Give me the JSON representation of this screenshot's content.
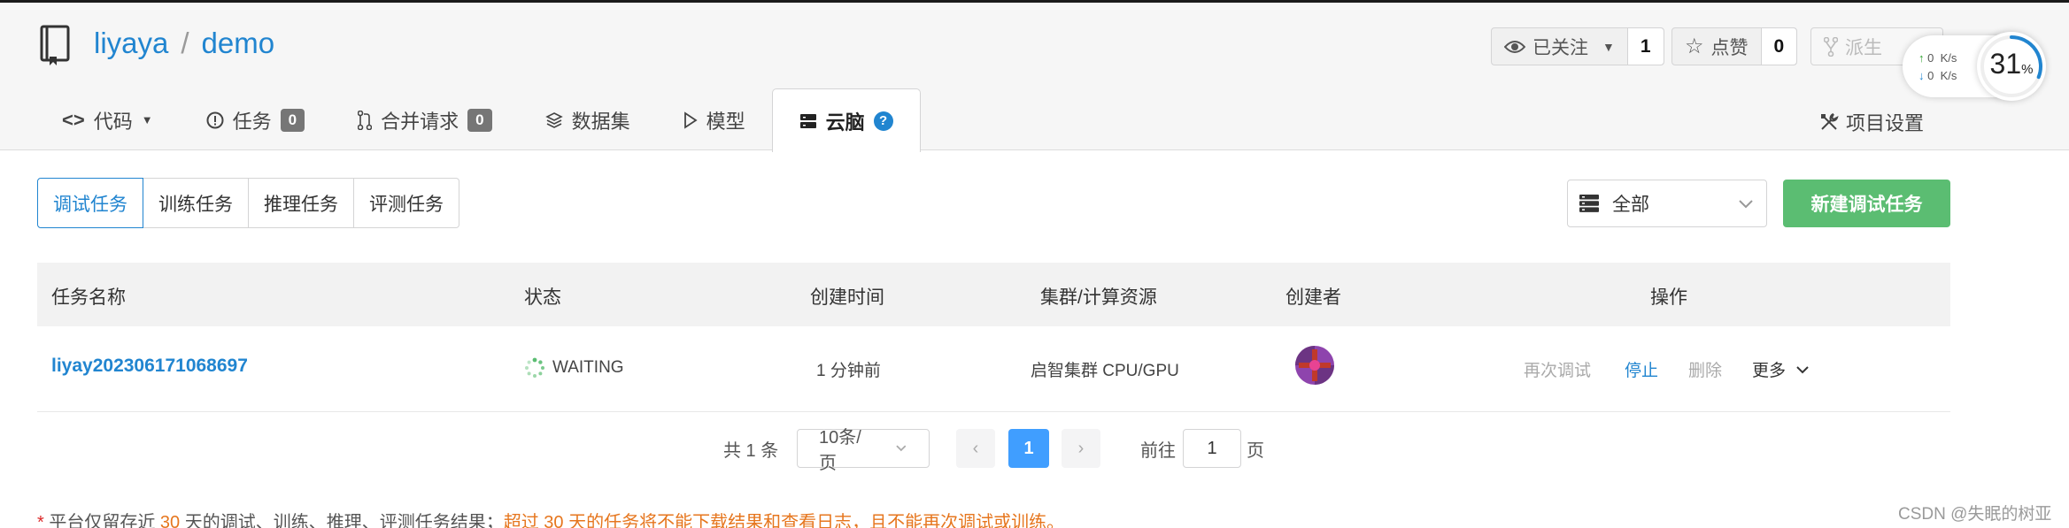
{
  "repo": {
    "owner": "liyaya",
    "separator": "/",
    "name": "demo"
  },
  "actions": {
    "watch": {
      "label": "已关注",
      "count": "1"
    },
    "star": {
      "label": "点赞",
      "count": "0"
    },
    "fork": {
      "label": "派生"
    }
  },
  "net_monitor": {
    "upload": "0",
    "download": "0",
    "unit": "K/s",
    "cpu_percent": "31",
    "percent_sign": "%"
  },
  "tabs": [
    {
      "label": "代码"
    },
    {
      "label": "任务",
      "badge": "0"
    },
    {
      "label": "合并请求",
      "badge": "0"
    },
    {
      "label": "数据集"
    },
    {
      "label": "模型"
    },
    {
      "label": "云脑",
      "help": "?"
    }
  ],
  "settings_label": "项目设置",
  "subtabs": [
    "调试任务",
    "训练任务",
    "推理任务",
    "评测任务"
  ],
  "filter": {
    "selected": "全部"
  },
  "new_task_label": "新建调试任务",
  "table": {
    "headers": [
      "任务名称",
      "状态",
      "创建时间",
      "集群/计算资源",
      "创建者",
      "操作"
    ],
    "rows": [
      {
        "name": "liyay20230617106869​7",
        "status": "WAITING",
        "created": "1 分钟前",
        "resource": "启智集群 CPU/GPU",
        "ops": {
          "rerun": "再次调试",
          "stop": "停止",
          "delete": "删除",
          "more": "更多"
        }
      }
    ]
  },
  "pagination": {
    "total": "共 1 条",
    "page_size": "10条/页",
    "current": "1",
    "goto_label": "前往",
    "goto_value": "1",
    "page_suffix": "页"
  },
  "note": {
    "star": "*",
    "part1": " 平台仅留存近 ",
    "days1": "30",
    "part2": " 天的调试、训练、推理、评测任务结果；",
    "part3": "超过 30 天的任务将不能下载结果和查看日志，且不能再次调试或训练。"
  },
  "watermark": "CSDN @失眠的树亚",
  "colors": {
    "accent": "#2185d0",
    "success": "#5bbd72",
    "warning": "#e6761e",
    "danger": "#db2828"
  }
}
